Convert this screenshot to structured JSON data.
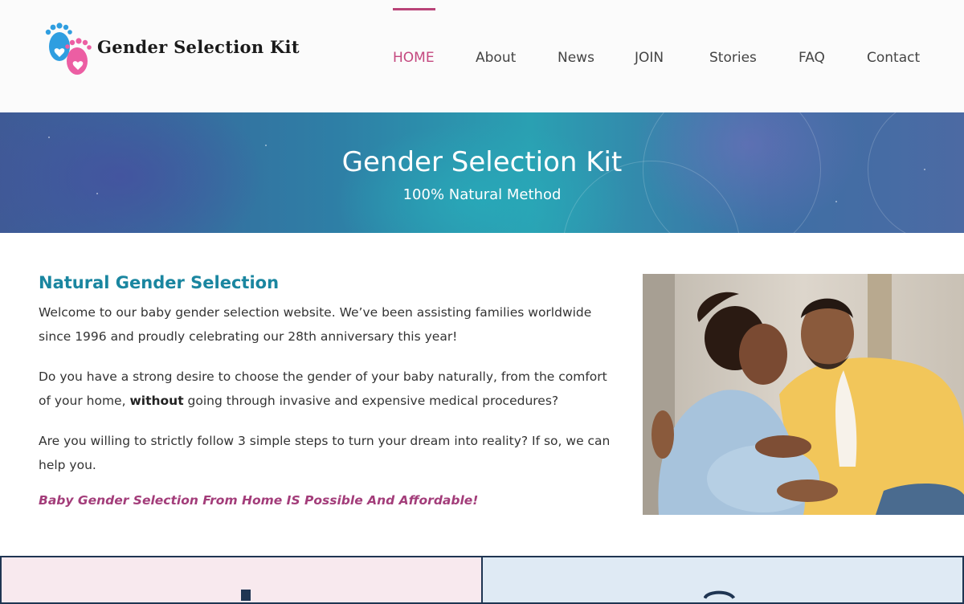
{
  "brand": {
    "name": "Gender Selection Kit",
    "colors": {
      "blue_foot": "#2f9ee0",
      "pink_foot": "#ec5ea3",
      "accent": "#c4487f"
    }
  },
  "nav": {
    "items": [
      {
        "label": "HOME",
        "active": true
      },
      {
        "label": "About",
        "active": false
      },
      {
        "label": "News",
        "active": false
      },
      {
        "label": "JOIN",
        "active": false
      },
      {
        "label": "Stories",
        "active": false
      },
      {
        "label": "FAQ",
        "active": false
      },
      {
        "label": "Contact",
        "active": false
      }
    ]
  },
  "hero": {
    "title": "Gender Selection Kit",
    "subtitle": "100% Natural Method"
  },
  "main": {
    "heading": "Natural Gender Selection",
    "paragraph1": "Welcome to our baby gender selection website. We’ve been assisting families worldwide since 1996 and proudly celebrating our 28th anniversary this year!",
    "paragraph2_before": "Do you have a strong desire to choose the gender of your baby naturally, from the comfort of your home, ",
    "paragraph2_bold": "without",
    "paragraph2_after": " going through invasive and expensive medical procedures?",
    "paragraph3": "Are you willing to strictly follow 3 simple steps to turn your dream into reality? If so, we can help you.",
    "tagline": "Baby Gender Selection From Home IS Possible And Affordable!"
  },
  "bottom": {
    "left_color": "#f8e9ee",
    "right_color": "#dfeaf4"
  }
}
